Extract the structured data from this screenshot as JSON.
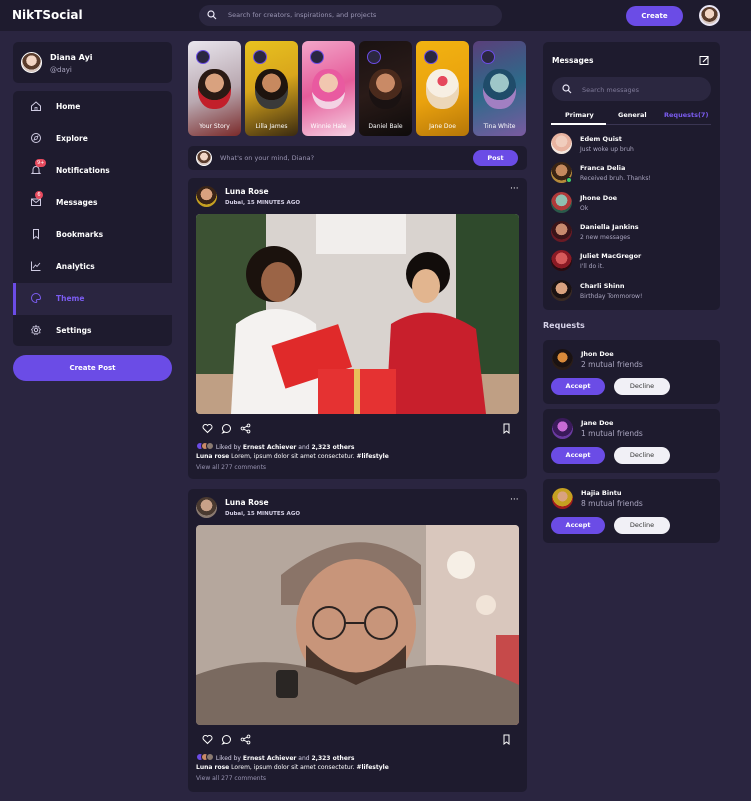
{
  "app": {
    "logo": "NikTSocial"
  },
  "navbar": {
    "search_placeholder": "Search for creators, inspirations, and projects",
    "create_label": "Create"
  },
  "profile": {
    "name": "Diana Ayi",
    "handle": "@dayi"
  },
  "sidebar": {
    "items": [
      {
        "label": "Home",
        "icon": "home-icon"
      },
      {
        "label": "Explore",
        "icon": "compass-icon"
      },
      {
        "label": "Notifications",
        "icon": "bell-icon",
        "badge": "9+"
      },
      {
        "label": "Messages",
        "icon": "mail-icon",
        "badge": "6"
      },
      {
        "label": "Bookmarks",
        "icon": "bookmark-icon"
      },
      {
        "label": "Analytics",
        "icon": "chart-icon"
      },
      {
        "label": "Theme",
        "icon": "palette-icon",
        "active": true
      },
      {
        "label": "Settings",
        "icon": "gear-icon"
      }
    ],
    "create_post_label": "Create Post"
  },
  "stories": [
    {
      "name": "Your Story"
    },
    {
      "name": "Lilla James"
    },
    {
      "name": "Winnie Hale"
    },
    {
      "name": "Daniel Bale"
    },
    {
      "name": "Jane Doe"
    },
    {
      "name": "Tina White"
    }
  ],
  "compose": {
    "placeholder": "What's on your mind, Diana?",
    "post_label": "Post"
  },
  "feed": [
    {
      "user": "Luna Rose",
      "location": "Dubai, 15 MINUTES AGO",
      "liked_by_prefix": "Liked by",
      "liked_by_name": "Ernest Achiever",
      "liked_by_and": "and",
      "liked_by_others": "2,323 others",
      "caption_user": "Luna rose",
      "caption_text": "Lorem, ipsum dolor sit amet consectetur.",
      "caption_tag": "#lifestyle",
      "comments": "View all 277 comments"
    },
    {
      "user": "Luna Rose",
      "location": "Dubai, 15 MINUTES AGO",
      "liked_by_prefix": "Liked by",
      "liked_by_name": "Ernest Achiever",
      "liked_by_and": "and",
      "liked_by_others": "2,323 others",
      "caption_user": "Luna rose",
      "caption_text": "Lorem, ipsum dolor sit amet consectetur.",
      "caption_tag": "#lifestyle",
      "comments": "View all 277 comments"
    }
  ],
  "messages": {
    "title": "Messages",
    "search_placeholder": "Search messages",
    "tabs": [
      "Primary",
      "General",
      "Requests(7)"
    ],
    "list": [
      {
        "name": "Edem Quist",
        "preview": "Just woke up bruh"
      },
      {
        "name": "Franca Delia",
        "preview": "Received bruh. Thanks!"
      },
      {
        "name": "Jhone Doe",
        "preview": "Ok"
      },
      {
        "name": "Daniella Jankins",
        "preview": "2 new messages"
      },
      {
        "name": "Juliet MacGregor",
        "preview": "I'll do it."
      },
      {
        "name": "Charli Shinn",
        "preview": "Birthday Tommorow!"
      }
    ]
  },
  "requests": {
    "title": "Requests",
    "accept_label": "Accept",
    "decline_label": "Decline",
    "list": [
      {
        "name": "Jhon Doe",
        "mutual": "2 mutual friends"
      },
      {
        "name": "Jane Doe",
        "mutual": "1 mutual friends"
      },
      {
        "name": "Hajia Bintu",
        "mutual": "8 mutual friends"
      }
    ]
  },
  "colors": {
    "accent": "#6b4ce6",
    "background": "#2a2540",
    "card": "#1e1b2e",
    "badge": "#e64a5e",
    "online": "#3ecf6a"
  }
}
